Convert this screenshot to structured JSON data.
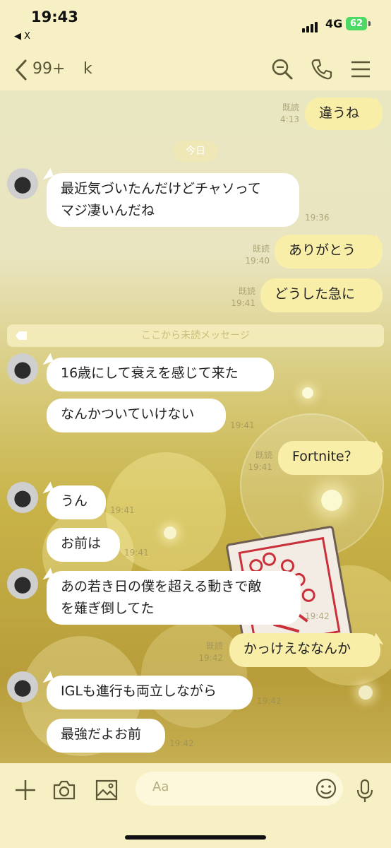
{
  "status": {
    "time": "19:43",
    "back_app": "◀ X",
    "network": "4G",
    "battery": "62"
  },
  "header": {
    "unread_count": "99+",
    "contact_name": "k"
  },
  "messages": [
    {
      "side": "out",
      "text": "違うね",
      "read": "既読",
      "time": "4:13"
    },
    {
      "side": "date",
      "text": "今日"
    },
    {
      "side": "in",
      "text": "最近気づいたんだけどチャソって\nマジ凄いんだね",
      "time": "19:36"
    },
    {
      "side": "out",
      "text": "ありがとう",
      "read": "既読",
      "time": "19:40"
    },
    {
      "side": "out",
      "text": "どうした急に",
      "read": "既読",
      "time": "19:41"
    },
    {
      "side": "divider",
      "text": "ここから未読メッセージ"
    },
    {
      "side": "in",
      "text": "16歳にして衰えを感じて来た",
      "time": ""
    },
    {
      "side": "in",
      "text": "なんかついていけない",
      "time": "19:41"
    },
    {
      "side": "out",
      "text": "Fortnite？",
      "read": "既読",
      "time": "19:41"
    },
    {
      "side": "in",
      "text": "うん",
      "time": "19:41"
    },
    {
      "side": "in",
      "text": "お前は",
      "time": "19:41"
    },
    {
      "side": "in",
      "text": "あの若き日の僕を超える動きで敵\nを薙ぎ倒してた",
      "time": "19:42"
    },
    {
      "side": "out",
      "text": "かっけえななんか",
      "read": "既読",
      "time": "19:42"
    },
    {
      "side": "in",
      "text": "IGLも進行も両立しながら",
      "time": "19:42"
    },
    {
      "side": "in",
      "text": "最強だよお前",
      "time": "19:42"
    }
  ],
  "input": {
    "placeholder": "Aa"
  },
  "icons": {
    "back": "chevron-left-icon",
    "search": "search-icon",
    "call": "phone-icon",
    "menu": "menu-icon",
    "add": "plus-icon",
    "camera": "camera-icon",
    "gallery": "image-icon",
    "emoji": "emoji-icon",
    "mic": "mic-icon"
  }
}
